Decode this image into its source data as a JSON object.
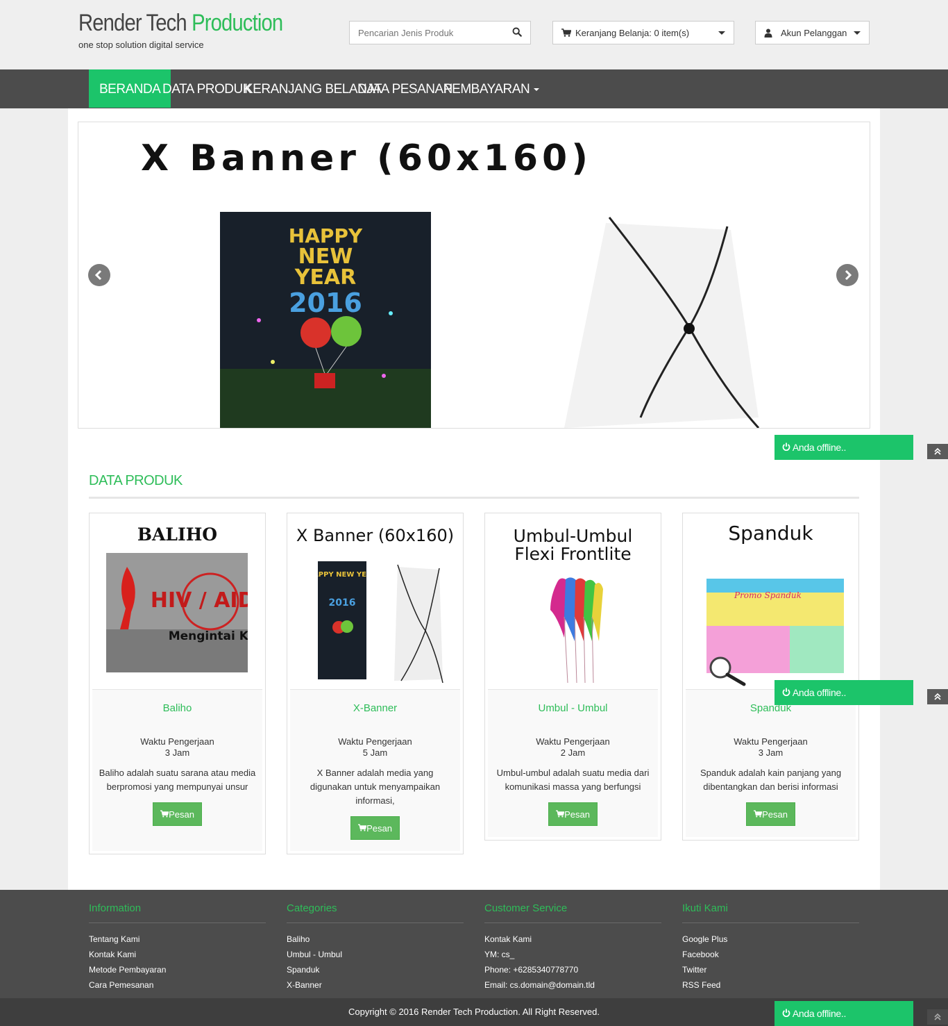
{
  "header": {
    "brand_main": "Render Tech",
    "brand_accent": "Production",
    "tagline": "one stop solution digital service",
    "search_placeholder": "Pencarian Jenis Produk",
    "cart_label": "Keranjang Belanja: 0 item(s)",
    "account_label": "Akun Pelanggan"
  },
  "nav": {
    "items": [
      {
        "label": "BERANDA"
      },
      {
        "label": "DATA PRODUK"
      },
      {
        "label": "KERANJANG BELANJA"
      },
      {
        "label": "DATA PESANAN"
      },
      {
        "label": "PEMBAYARAN"
      }
    ]
  },
  "slider": {
    "title": "X Banner (60x160)",
    "poster_text": [
      "HAPPY",
      "NEW",
      "YEAR",
      "2016"
    ]
  },
  "products_section": {
    "title": "DATA PRODUK"
  },
  "products": [
    {
      "image_title": "BALIHO",
      "name": "Baliho",
      "time_label": "Waktu Pengerjaan",
      "time_value": "3 Jam",
      "description": "Baliho adalah suatu sarana atau media berpromosi yang mempunyai unsur",
      "button": "Pesan",
      "poster_main": "HIV / AIDS",
      "poster_sub": "Mengintai Kita"
    },
    {
      "image_title": "X Banner (60x160)",
      "name": "X-Banner",
      "time_label": "Waktu Pengerjaan",
      "time_value": "5 Jam",
      "description": "X Banner adalah media yang digunakan untuk menyampaikan informasi,",
      "button": "Pesan",
      "poster_main": "HAPPY NEW YEAR",
      "poster_sub": "2016"
    },
    {
      "image_title_1": "Umbul-Umbul",
      "image_title_2": "Flexi Frontlite",
      "name": "Umbul - Umbul",
      "time_label": "Waktu Pengerjaan",
      "time_value": "2 Jam",
      "description": "Umbul-umbul adalah suatu media dari komunikasi massa yang berfungsi",
      "button": "Pesan"
    },
    {
      "image_title": "Spanduk",
      "name": "Spanduk",
      "time_label": "Waktu Pengerjaan",
      "time_value": "3 Jam",
      "description": "Spanduk adalah kain panjang yang dibentangkan dan berisi informasi",
      "button": "Pesan",
      "poster_main": "Promo Spanduk"
    }
  ],
  "footer": {
    "columns": [
      {
        "title": "Information",
        "links": [
          "Tentang Kami",
          "Kontak Kami",
          "Metode Pembayaran",
          "Cara Pemesanan"
        ]
      },
      {
        "title": "Categories",
        "links": [
          "Baliho",
          "Umbul - Umbul",
          "Spanduk",
          "X-Banner"
        ]
      },
      {
        "title": "Customer Service",
        "links": [
          "Kontak Kami",
          "YM: cs_",
          "Phone: +6285340778770",
          "Email: cs.domain@domain.tld"
        ]
      },
      {
        "title": "Ikuti Kami",
        "links": [
          "Google Plus",
          "Facebook",
          "Twitter",
          "RSS Feed"
        ]
      }
    ],
    "copyright": "Copyright © 2016 Render Tech Production. All Right Reserved."
  },
  "chat": {
    "offline_label": "Anda offline.."
  },
  "colors": {
    "accent": "#2ebd59",
    "nav_bg": "#4c4c4c",
    "nav_active": "#1cc46a",
    "button": "#5cb85c"
  },
  "icons": [
    "search-icon",
    "cart-icon",
    "user-icon",
    "chevron-left-icon",
    "chevron-right-icon",
    "power-icon",
    "double-chevron-up-icon"
  ]
}
